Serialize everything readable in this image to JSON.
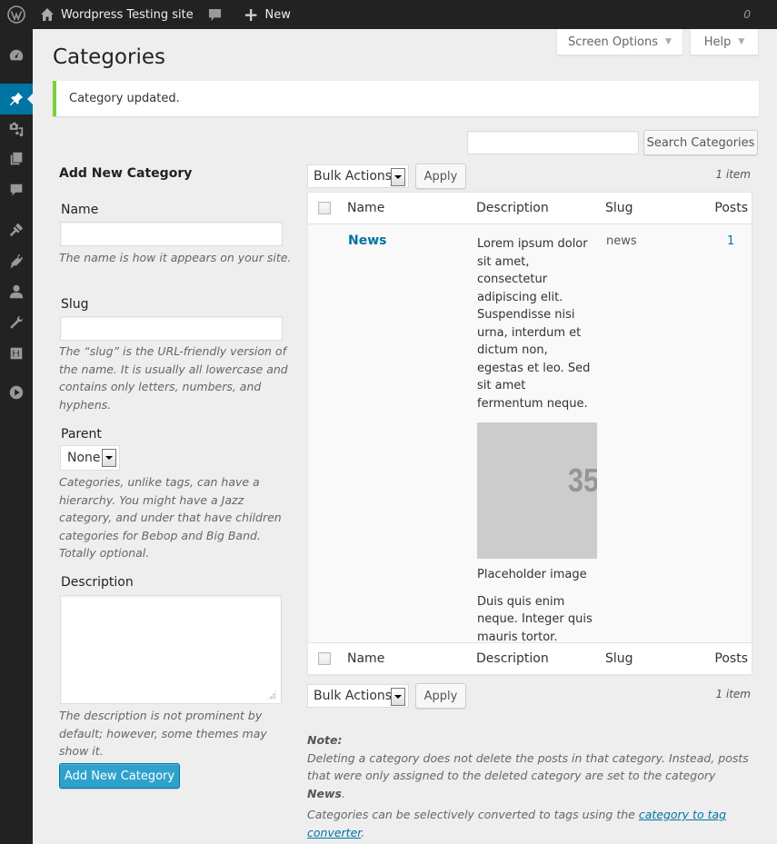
{
  "adminbar": {
    "site_name": "Wordpress Testing site",
    "comments_count": "0",
    "new_label": "New"
  },
  "adminmenu": {
    "items": [
      {
        "icon": "dashboard-icon",
        "current": false
      },
      {
        "icon": "pin-icon",
        "label": "Posts",
        "current": true
      },
      {
        "icon": "media-icon",
        "current": false
      },
      {
        "icon": "pages-icon",
        "current": false
      },
      {
        "icon": "comments-icon",
        "current": false
      },
      {
        "icon": "appearance-brush-icon",
        "current": false
      },
      {
        "icon": "plugins-icon",
        "current": false
      },
      {
        "icon": "users-icon",
        "current": false
      },
      {
        "icon": "tools-wrench-icon",
        "current": false
      },
      {
        "icon": "settings-sliders-icon",
        "current": false
      },
      {
        "icon": "play-icon",
        "current": false
      }
    ]
  },
  "screen_meta": {
    "screen_options": "Screen Options",
    "help": "Help"
  },
  "page": {
    "title": "Categories",
    "notice": "Category updated."
  },
  "search": {
    "value": "",
    "button": "Search Categories"
  },
  "form": {
    "title": "Add New Category",
    "name_label": "Name",
    "name_value": "",
    "name_help": "The name is how it appears on your site.",
    "slug_label": "Slug",
    "slug_value": "",
    "slug_help": "The “slug” is the URL-friendly version of the name. It is usually all lowercase and contains only letters, numbers, and hyphens.",
    "parent_label": "Parent",
    "parent_selected": "None",
    "parent_help": "Categories, unlike tags, can have a hierarchy. You might have a Jazz category, and under that have children categories for Bebop and Big Band. Totally optional.",
    "description_label": "Description",
    "description_value": "",
    "description_help": "The description is not prominent by default; however, some themes may show it.",
    "submit": "Add New Category"
  },
  "table": {
    "bulk_actions": "Bulk Actions",
    "apply": "Apply",
    "count": "1 item",
    "columns": [
      "Name",
      "Description",
      "Slug",
      "Posts"
    ],
    "rows": [
      {
        "name": "News",
        "description_p1": "Lorem ipsum dolor sit amet, consectetur adipiscing elit. Suspendisse nisi urna, interdum et dictum non, egestas et leo. Sed sit amet fermentum neque.",
        "image_text": "35",
        "image_caption": "Placeholder image",
        "description_p2": "Duis quis enim neque. Integer quis mauris tortor.",
        "slug": "news",
        "posts": "1"
      }
    ]
  },
  "note": {
    "heading": "Note:",
    "line1_prefix": "Deleting a category does not delete the posts in that category. Instead, posts that were only assigned to the deleted category are set to the category ",
    "line1_bold": "News",
    "line1_suffix": ".",
    "line2_prefix": "Categories can be selectively converted to tags using the ",
    "line2_link": "category to tag converter",
    "line2_suffix": "."
  },
  "colors": {
    "accent": "#0074a2",
    "primary_button": "#2ea2cc",
    "notice_success": "#7ad03a",
    "adminbar_bg": "#222222"
  }
}
